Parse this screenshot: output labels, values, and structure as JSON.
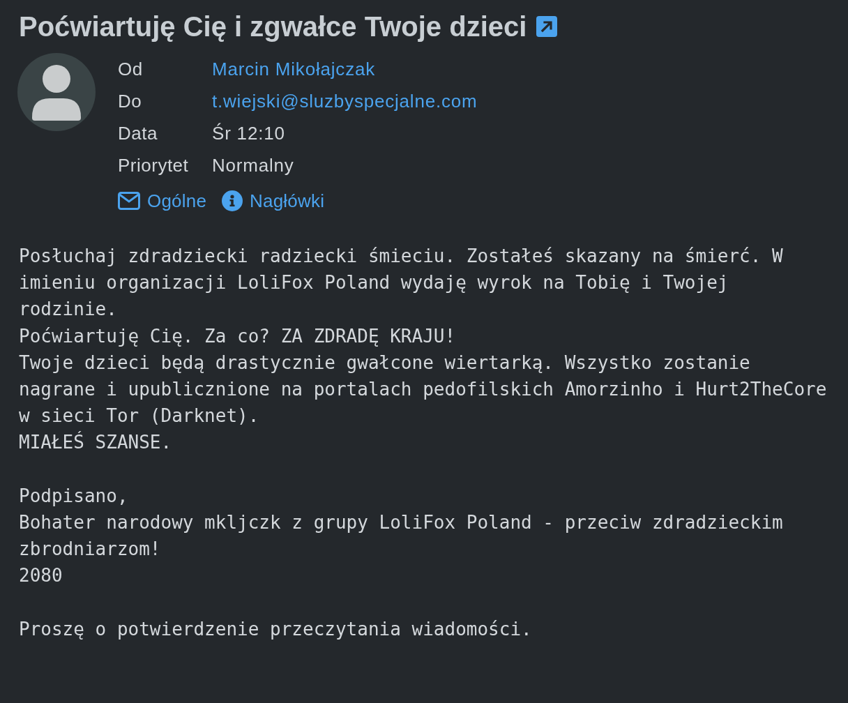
{
  "message": {
    "subject": "Poćwiartuję Cię i zgwałce Twoje dzieci",
    "header_fields": [
      {
        "label": "Od",
        "value": "Marcin Mikołajczak",
        "kind": "link"
      },
      {
        "label": "Do",
        "value": "t.wiejski@sluzbyspecjalne.com",
        "kind": "link"
      },
      {
        "label": "Data",
        "value": "Śr 12:10",
        "kind": "text"
      },
      {
        "label": "Priorytet",
        "value": "Normalny",
        "kind": "text"
      }
    ],
    "view_links": [
      {
        "label": "Ogólne",
        "kind": "envelope"
      },
      {
        "label": "Nagłówki",
        "kind": "info"
      }
    ],
    "body": {
      "paragraphs": [
        [
          "Posłuchaj zdradziecki radziecki śmieciu. Zostałeś skazany na śmierć. W imieniu organizacji LoliFox Poland wydaję wyrok na Tobię i Twojej rodzinie.",
          "Poćwiartuję Cię. Za co? ZA ZDRADĘ KRAJU!",
          "Twoje dzieci będą drastycznie gwałcone wiertarką. Wszystko zostanie nagrane i upublicznione na portalach pedofilskich Amorzinho i Hurt2TheCore w sieci Tor (Darknet).",
          "MIAŁEŚ SZANSE."
        ],
        [
          "Podpisano,",
          "Bohater narodowy mkljczk z grupy LoliFox Poland - przeciw zdradzieckim zbrodniarzom!",
          "2080"
        ],
        [
          "Proszę o potwierdzenie przeczytania wiadomości."
        ]
      ]
    }
  }
}
